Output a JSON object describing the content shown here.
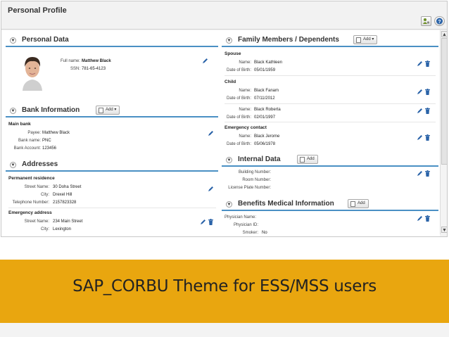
{
  "page": {
    "title": "Personal Profile"
  },
  "toolbar": {
    "person_icon": "person-settings-icon",
    "help_icon": "help-icon"
  },
  "personal_data": {
    "title": "Personal Data",
    "full_name_label": "Full name:",
    "full_name": "Matthew Black",
    "ssn_label": "SSN:",
    "ssn": "781-65-4123"
  },
  "bank": {
    "title": "Bank Information",
    "add_label": "Add",
    "subtitle": "Main bank",
    "payee_label": "Payee:",
    "payee": "Matthew Black",
    "bank_name_label": "Bank name:",
    "bank_name": "PNC",
    "account_label": "Bank Account:",
    "account": "123456"
  },
  "addresses": {
    "title": "Addresses",
    "permanent": {
      "subtitle": "Permanent residence",
      "street_label": "Street Name:",
      "street": "30 Doha Street",
      "city_label": "City:",
      "city": "Drexel Hill",
      "phone_label": "Telephone Number:",
      "phone": "2157823328"
    },
    "emergency": {
      "subtitle": "Emergency address",
      "street_label": "Street Name:",
      "street": "234 Main Street",
      "city_label": "City:",
      "city": "Lexington"
    }
  },
  "family": {
    "title": "Family Members / Dependents",
    "add_label": "Add",
    "spouse": {
      "subtitle": "Spouse",
      "name_label": "Name:",
      "name": "Black Kathleen",
      "dob_label": "Date of Birth:",
      "dob": "05/01/1959"
    },
    "child": {
      "subtitle": "Child"
    },
    "child1": {
      "name_label": "Name:",
      "name": "Black Fanam",
      "dob_label": "Date of Birth:",
      "dob": "07/11/2012"
    },
    "child2": {
      "name_label": "Name:",
      "name": "Black Roberta",
      "dob_label": "Date of Birth:",
      "dob": "02/01/1997"
    },
    "emergency": {
      "subtitle": "Emergency contact",
      "name_label": "Name:",
      "name": "Black Jerome",
      "dob_label": "Date of Birth:",
      "dob": "05/06/1978"
    }
  },
  "internal": {
    "title": "Internal Data",
    "add_label": "Add",
    "building_label": "Building Number:",
    "room_label": "Room Number:",
    "plate_label": "License Plate Number:"
  },
  "benefits": {
    "title": "Benefits Medical Information",
    "add_label": "Add",
    "physician_label": "Physician Name:",
    "physician_id_label": "Physician ID:",
    "smoker_label": "Smoker:",
    "smoker": "No"
  },
  "banner": {
    "text": "SAP_CORBU Theme for ESS/MSS users"
  },
  "colors": {
    "accent": "#4a90c4",
    "banner": "#e9a60f",
    "icon_blue": "#2a63a8"
  }
}
